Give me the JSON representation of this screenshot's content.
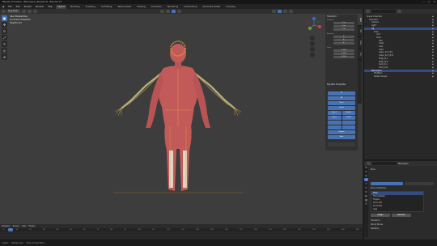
{
  "window": {
    "title": "Blender [C:\\Users\\...\\Mannequin_Rig.blend] - Blender 4.1",
    "controls": [
      "—",
      "▢",
      "✕"
    ]
  },
  "menubar": {
    "items": [
      "File",
      "Edit",
      "Render",
      "Window",
      "Help"
    ],
    "workspaces": [
      "Layout",
      "Modeling",
      "Sculpting",
      "UV Editing",
      "Texture Paint",
      "Shading",
      "Animation",
      "Rendering",
      "Compositing",
      "Geometry Nodes",
      "Scripting"
    ],
    "active_workspace": "Layout"
  },
  "viewport": {
    "stats": [
      "User Perspective",
      "(1) Scene Collection",
      "Objects 1/3"
    ],
    "mode": "Pose Mode",
    "tools": [
      "▣",
      "✥",
      "↻",
      "⤢",
      "✎",
      "◎",
      "⊕"
    ],
    "npanel": {
      "header": "Transform",
      "location_label": "Location",
      "rotation_label": "Rotation",
      "scale_label": "Scale",
      "fields": [
        "0 m",
        "0 m",
        "0 m",
        "0°",
        "0°",
        "0°",
        "1.000",
        "1.000",
        "1.000"
      ],
      "section_label": "Rig Main Properties",
      "buttons": [
        "IK",
        "FK",
        "Torso",
        "Head",
        "Arm.L",
        "Arm.R",
        "Leg.L",
        "Leg.R",
        "Fingers",
        "Root"
      ],
      "tabs": [
        "Item",
        "Tool",
        "View",
        "Rig"
      ]
    }
  },
  "timeline": {
    "header_items": [
      "Playback",
      "Keying",
      "View",
      "Marker"
    ],
    "ticks": [
      "0",
      "10",
      "20",
      "30",
      "40",
      "50",
      "60",
      "70",
      "80",
      "90",
      "100",
      "110",
      "120",
      "130",
      "140",
      "150",
      "160",
      "170",
      "180",
      "190",
      "200",
      "210",
      "220",
      "230",
      "240",
      "250"
    ],
    "current_frame": "1"
  },
  "statusbar": {
    "items": [
      "Select",
      "Rotate View",
      "Pose Context Menu"
    ]
  },
  "outliner": {
    "rows": [
      {
        "label": "Scene Collection",
        "indent": 0,
        "selected": false
      },
      {
        "label": "Collection",
        "indent": 1,
        "selected": false
      },
      {
        "label": "Camera",
        "indent": 2,
        "selected": false
      },
      {
        "label": "Light",
        "indent": 2,
        "selected": false
      },
      {
        "label": "rig",
        "indent": 2,
        "selected": true
      },
      {
        "label": "Pose",
        "indent": 3,
        "selected": false
      },
      {
        "label": "root",
        "indent": 4,
        "selected": false
      },
      {
        "label": "torso",
        "indent": 4,
        "selected": false
      },
      {
        "label": "hips",
        "indent": 5,
        "selected": false
      },
      {
        "label": "chest",
        "indent": 5,
        "selected": false
      },
      {
        "label": "neck",
        "indent": 5,
        "selected": false
      },
      {
        "label": "head",
        "indent": 5,
        "selected": false
      },
      {
        "label": "upper_arm_fk.L",
        "indent": 5,
        "selected": false
      },
      {
        "label": "upper_arm_fk.R",
        "indent": 5,
        "selected": false
      },
      {
        "label": "thigh_fk.L",
        "indent": 5,
        "selected": false
      },
      {
        "label": "thigh_fk.R",
        "indent": 5,
        "selected": false
      },
      {
        "label": "hand_ik.L",
        "indent": 5,
        "selected": false
      },
      {
        "label": "hand_ik.R",
        "indent": 5,
        "selected": false
      },
      {
        "label": "Mannequin",
        "indent": 2,
        "selected": true
      },
      {
        "label": "Modifiers",
        "indent": 3,
        "selected": false
      },
      {
        "label": "Vertex Groups",
        "indent": 3,
        "selected": false
      }
    ]
  },
  "properties": {
    "tabs": [
      "⚙",
      "⎚",
      "◈",
      "✦",
      "⬡",
      "⚲",
      "⛭",
      "◐",
      "▦",
      "☰"
    ],
    "active_tab": 3,
    "header": "Mannequin",
    "rows": [
      "Bone",
      "Transform",
      "Bendy Bones",
      "Relations"
    ],
    "list_header": "Bone Collections",
    "list_items": [
      "Torso",
      "Torso (Tweak)",
      "Fingers",
      "Arm.L (IK)",
      "Arm.R (IK)",
      "Legs"
    ],
    "assign_label": "Assign",
    "remove_label": "Remove"
  }
}
